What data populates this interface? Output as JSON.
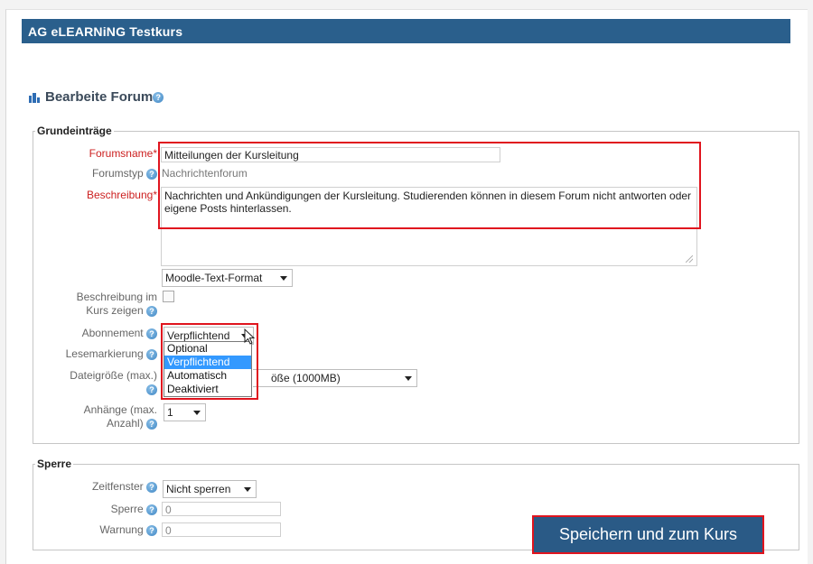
{
  "course": {
    "title": "AG eLEARNiNG Testkurs"
  },
  "page": {
    "heading": "Bearbeite Forum"
  },
  "grundeintraege": {
    "legend": "Grundeinträge",
    "forumsname_label": "Forumsname",
    "forumsname_value": "Mitteilungen der Kursleitung",
    "forumstyp_label": "Forumstyp",
    "forumstyp_value": "Nachrichtenforum",
    "beschreibung_label": "Beschreibung",
    "beschreibung_value": "Nachrichten und Ankündigungen der Kursleitung. Studierenden können in diesem Forum nicht antworten oder eigene Posts hinterlassen.",
    "format_value": "Moodle-Text-Format",
    "beschreibung_zeigen_label_1": "Beschreibung im",
    "beschreibung_zeigen_label_2": "Kurs zeigen",
    "abonnement_label": "Abonnement",
    "abonnement_value": "Verpflichtend",
    "abonnement_options": [
      "Optional",
      "Verpflichtend",
      "Automatisch",
      "Deaktiviert"
    ],
    "abonnement_selected_index": 1,
    "lesemarkierung_label": "Lesemarkierung",
    "dateigroesse_label_1": "Dateigröße (max.)",
    "dateigroesse_value_visible": "öße (1000MB)",
    "anhaenge_label_1": "Anhänge (max.",
    "anhaenge_label_2": "Anzahl)",
    "anhaenge_value": "1"
  },
  "sperre": {
    "legend": "Sperre",
    "zeitfenster_label": "Zeitfenster",
    "zeitfenster_value": "Nicht sperren",
    "sperre_label": "Sperre",
    "sperre_value": "0",
    "warnung_label": "Warnung",
    "warnung_value": "0"
  },
  "actions": {
    "save_label": "Speichern und zum Kurs"
  },
  "icons": {
    "help": "help-icon",
    "forum": "forum-icon",
    "dropdown": "chevron-down-icon"
  },
  "colors": {
    "header": "#2a5f8c",
    "highlight": "#e0141e",
    "required": "#cc1f1f",
    "selection": "#3399ff"
  }
}
